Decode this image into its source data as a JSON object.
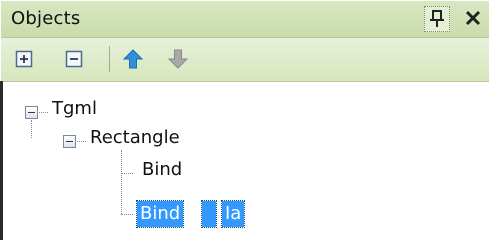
{
  "panel": {
    "title": "Objects"
  },
  "toolbar": {
    "icons": [
      "expand-all-icon",
      "collapse-all-icon",
      "move-up-icon",
      "move-down-icon"
    ]
  },
  "tree": {
    "root": {
      "label": "Tgml",
      "expanded": true
    },
    "child": {
      "label": "Rectangle",
      "expanded": true
    },
    "items": [
      {
        "label": "Bind"
      },
      {
        "label": "Bind",
        "selected": true,
        "suffix": "Ia"
      }
    ]
  },
  "colors": {
    "titlebar": "#cbdcab",
    "toolbar": "#d6e6bd",
    "selection": "#3399ff",
    "arrow_up": "#2f8fdc",
    "arrow_down": "#a8a8a8"
  }
}
